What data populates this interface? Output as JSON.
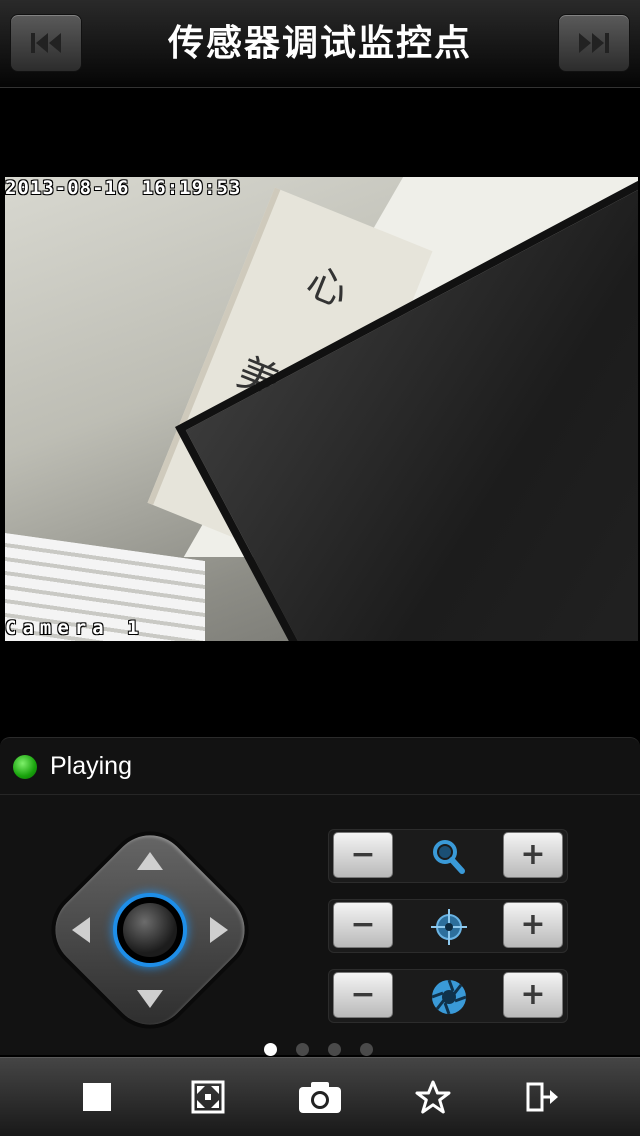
{
  "header": {
    "title": "传感器调试监控点",
    "prev_icon": "skip-previous-icon",
    "next_icon": "skip-next-icon"
  },
  "video": {
    "timestamp": "2013-08-16 16:19:53",
    "camera_label": "Camera 1"
  },
  "status": {
    "text": "Playing",
    "indicator_color": "#1fb010"
  },
  "ptz": {
    "accent_color": "#1e8ee8",
    "rows": [
      {
        "name": "zoom",
        "icon": "magnifier-icon",
        "minus": "−",
        "plus": "+"
      },
      {
        "name": "focus",
        "icon": "focus-target-icon",
        "minus": "−",
        "plus": "+"
      },
      {
        "name": "iris",
        "icon": "aperture-icon",
        "minus": "−",
        "plus": "+"
      }
    ]
  },
  "pager": {
    "count": 4,
    "active_index": 0
  },
  "toolbar": {
    "items": [
      "stop-icon",
      "fullscreen-icon",
      "camera-snapshot-icon",
      "favorite-star-icon",
      "exit-icon"
    ]
  }
}
